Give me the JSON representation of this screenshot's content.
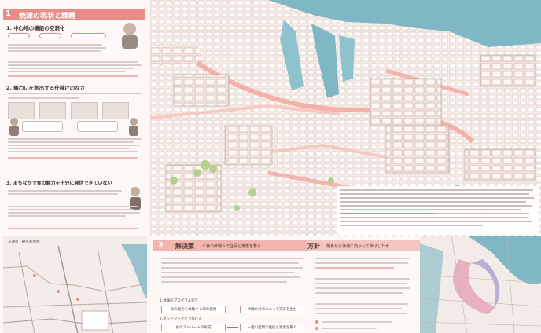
{
  "section1": {
    "number": "1",
    "title": "焼津の現状と課題"
  },
  "issues": [
    {
      "heading": "1. 中心地の機能の空洞化"
    },
    {
      "heading": "2. 賑わいを創出する仕掛けのなさ"
    },
    {
      "heading": "3. まちなかで食の魅力を十分に発信できていない"
    }
  ],
  "left_map": {
    "label": "交通量・観光客現状"
  },
  "section2": {
    "number": "2",
    "title": "解決策",
    "subtitle": "＜食の体験＞で住民と漁業を繋ぐ",
    "policy_label": "方針",
    "policy_text": "朝食から漁港に向かって伸ばした木"
  },
  "program": {
    "item1": "1.体験のプログラム作り",
    "item2": "2.ネットワークをつなげる",
    "box1_left": "食の魅力を体験する場の提供",
    "box1_right": "仲間の共有によって交流を生む",
    "box2_left": "食のストリートの形成",
    "box2_right": "一連の空間で住民と漁業を繋ぐ"
  },
  "colors": {
    "accent": "#e98b87",
    "accent_light": "#f1b5b0",
    "water": "#7fb8c4"
  }
}
